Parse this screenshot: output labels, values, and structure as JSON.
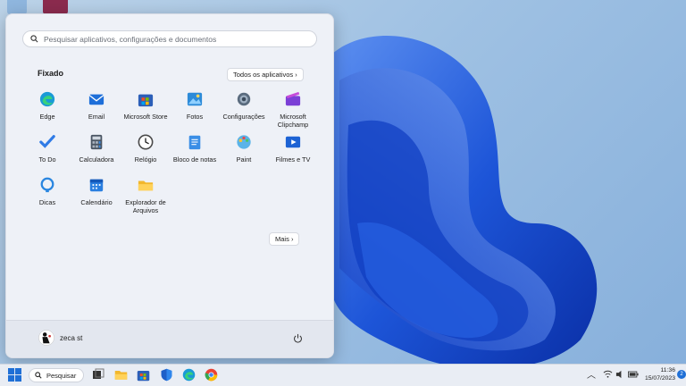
{
  "start_menu": {
    "search_placeholder": "Pesquisar aplicativos, configurações e documentos",
    "pinned_title": "Fixado",
    "all_apps_label": "Todos os aplicativos",
    "more_label": "Mais",
    "apps": [
      {
        "label": "Edge",
        "icon": "edge-icon"
      },
      {
        "label": "Email",
        "icon": "mail-icon"
      },
      {
        "label": "Microsoft Store",
        "icon": "store-icon"
      },
      {
        "label": "Fotos",
        "icon": "photos-icon"
      },
      {
        "label": "Configurações",
        "icon": "settings-gear-icon"
      },
      {
        "label": "Microsoft Clipchamp",
        "icon": "clipchamp-icon"
      },
      {
        "label": "To Do",
        "icon": "todo-check-icon"
      },
      {
        "label": "Calculadora",
        "icon": "calculator-icon"
      },
      {
        "label": "Relógio",
        "icon": "clock-icon"
      },
      {
        "label": "Bloco de notas",
        "icon": "notepad-icon"
      },
      {
        "label": "Paint",
        "icon": "paint-icon"
      },
      {
        "label": "Filmes e TV",
        "icon": "movies-tv-icon"
      },
      {
        "label": "Dicas",
        "icon": "tips-icon"
      },
      {
        "label": "Calendário",
        "icon": "calendar-icon"
      },
      {
        "label": "Explorador de Arquivos",
        "icon": "file-explorer-icon"
      }
    ],
    "user_name": "zeca st"
  },
  "taskbar": {
    "search_label": "Pesquisar",
    "time": "11:36",
    "date": "15/07/2023",
    "notification_count": "2"
  },
  "colors": {
    "accent": "#1f6fd6",
    "wallpaper_blue": "#1a4fd0"
  }
}
